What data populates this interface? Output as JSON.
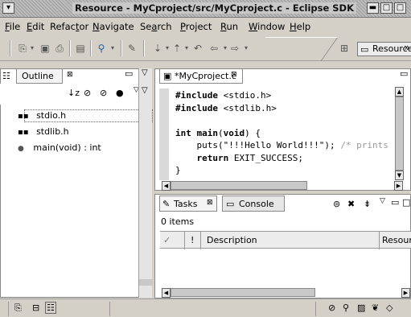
{
  "window": {
    "title": "Resource - MyCproject/src/MyCproject.c - Eclipse SDK"
  },
  "menu": [
    {
      "pre": "",
      "ul": "F",
      "post": "ile"
    },
    {
      "pre": "",
      "ul": "E",
      "post": "dit"
    },
    {
      "pre": "Refac",
      "ul": "t",
      "post": "or"
    },
    {
      "pre": "",
      "ul": "N",
      "post": "avigate"
    },
    {
      "pre": "Se",
      "ul": "a",
      "post": "rch"
    },
    {
      "pre": "",
      "ul": "P",
      "post": "roject"
    },
    {
      "pre": "",
      "ul": "R",
      "post": "un"
    },
    {
      "pre": "",
      "ul": "W",
      "post": "indow"
    },
    {
      "pre": "",
      "ul": "H",
      "post": "elp"
    }
  ],
  "toolbar": {
    "perspective_label": "Resource",
    "overflow_label": "»"
  },
  "outline": {
    "tab_label": "Outline",
    "items": [
      {
        "label": "stdio.h",
        "icon": "include-icon"
      },
      {
        "label": "stdlib.h",
        "icon": "include-icon"
      },
      {
        "label": "main(void) : int",
        "icon": "function-icon"
      }
    ]
  },
  "editor": {
    "tab_label": "*MyCproject.c",
    "lines": [
      [
        {
          "t": "#include",
          "k": 1
        },
        {
          "t": " <stdio.h>",
          "k": 0
        }
      ],
      [
        {
          "t": "#include",
          "k": 1
        },
        {
          "t": " <stdlib.h>",
          "k": 0
        }
      ],
      [
        {
          "t": "",
          "k": 0
        }
      ],
      [
        {
          "t": "int",
          "k": 1
        },
        {
          "t": " ",
          "k": 0
        },
        {
          "t": "main",
          "k": 1
        },
        {
          "t": "(",
          "k": 0
        },
        {
          "t": "void",
          "k": 1
        },
        {
          "t": ") {",
          "k": 0
        }
      ],
      [
        {
          "t": "    puts(\"!!!Hello World!!!\"); ",
          "k": 0
        },
        {
          "t": "/* prints",
          "k": 2
        }
      ],
      [
        {
          "t": "    ",
          "k": 0
        },
        {
          "t": "return",
          "k": 1
        },
        {
          "t": " EXIT_SUCCESS;",
          "k": 0
        }
      ],
      [
        {
          "t": "}",
          "k": 0
        }
      ]
    ]
  },
  "bottom": {
    "tasks_tab": "Tasks",
    "console_tab": "Console",
    "items_count": "0 items",
    "columns": [
      "✓",
      "!",
      "Description",
      "Resour"
    ]
  }
}
